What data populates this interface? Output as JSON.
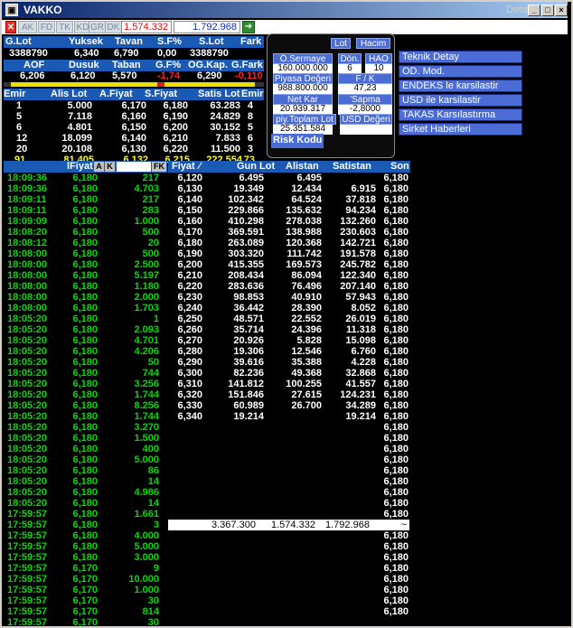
{
  "window": {
    "title": "VAKKO",
    "subtitle": "Detay",
    "sys_glyph": "▣",
    "min": "_",
    "max": "□",
    "close": "×"
  },
  "toolbar": {
    "buttons": [
      "✕",
      "AK",
      "FD",
      "TK",
      "KD",
      "GR",
      "DK"
    ],
    "value_red": "1.574.332",
    "value_blue": "1.792.968",
    "go": "➔"
  },
  "summary": {
    "headers1": [
      "G.Lot",
      "Yuksek",
      "Tavan",
      "S.F%",
      "S.Lot",
      "Fark"
    ],
    "values1": [
      "3388790",
      "6,340",
      "6,790",
      "0,00",
      "3388790",
      ""
    ],
    "headers2": [
      "AOF",
      "Dusuk",
      "Taban",
      "G.F%",
      "OG.Kap.",
      "G.Fark"
    ],
    "values2": [
      "6,206",
      "6,120",
      "5,570",
      "-1,74",
      "6,290",
      "-0,110"
    ]
  },
  "depth": {
    "headers": [
      "Emir",
      "Alis Lot",
      "A.Fiyat",
      "S.Fiyat",
      "Satis Lot",
      "Emir"
    ],
    "rows": [
      [
        "1",
        "5.000",
        "6,170",
        "6,180",
        "63.283",
        "4"
      ],
      [
        "5",
        "7.118",
        "6,160",
        "6,190",
        "24.829",
        "8"
      ],
      [
        "6",
        "4.801",
        "6,150",
        "6,200",
        "30.152",
        "5"
      ],
      [
        "12",
        "18.099",
        "6,140",
        "6,210",
        "7.833",
        "6"
      ],
      [
        "20",
        "20.108",
        "6,130",
        "6,220",
        "11.500",
        "3"
      ]
    ],
    "total": [
      "91",
      "81.405",
      "6,132",
      "6,215",
      "222.554",
      "73"
    ]
  },
  "info_panel": {
    "lot_btn": "Lot",
    "hacim_btn": "Hacim",
    "sermaye_label": "Ö.Sermaye",
    "sermaye_value": "160.000.000",
    "don_label": "Dön.",
    "don_value": "6",
    "hao_label": "HAO",
    "hao_value": "10",
    "piyasa_label": "Piyasa Değeri",
    "piyasa_value": "988.800.000",
    "fk_label": "F / K",
    "fk_value": "47,23",
    "netkar_label": "Net Kar",
    "netkar_value": "20.939.317",
    "sapma_label": "'Sapma",
    "sapma_value": "-2,8000",
    "toplam_label": "piy.Toplam Lot",
    "toplam_value": "25.351.584",
    "usd_label": "USD Değeri",
    "usd_value": "",
    "risk_label": "Risk Kodu"
  },
  "menu": [
    "Teknik Detay",
    "OD. Mod.",
    "ENDEKS le karsilastir",
    "USD ile karsilastir",
    "TAKAS Karsılastırma",
    "Sirket Haberleri"
  ],
  "trades": {
    "header_fiyat": "lFiyat",
    "btn_a": "A",
    "btn_k": "K",
    "btn_fk": "FK",
    "rows": [
      [
        "18:09:36",
        "6,180",
        "217"
      ],
      [
        "18:09:36",
        "6,180",
        "4.703"
      ],
      [
        "18:09:11",
        "6,180",
        "217"
      ],
      [
        "18:09:11",
        "6,180",
        "283"
      ],
      [
        "18:09:09",
        "6,180",
        "1.000"
      ],
      [
        "18:08:20",
        "6,180",
        "500"
      ],
      [
        "18:08:12",
        "6,180",
        "20"
      ],
      [
        "18:08:00",
        "6,180",
        "500"
      ],
      [
        "18:08:00",
        "6,180",
        "2.500"
      ],
      [
        "18:08:00",
        "6,180",
        "5.197"
      ],
      [
        "18:08:00",
        "6,180",
        "1.180"
      ],
      [
        "18:08:00",
        "6,180",
        "2.000"
      ],
      [
        "18:08:00",
        "6,180",
        "1.703"
      ],
      [
        "18:05:20",
        "6,180",
        "1"
      ],
      [
        "18:05:20",
        "6,180",
        "2.093"
      ],
      [
        "18:05:20",
        "6,180",
        "4.701"
      ],
      [
        "18:05:20",
        "6,180",
        "4.206"
      ],
      [
        "18:05:20",
        "6,180",
        "50"
      ],
      [
        "18:05:20",
        "6,180",
        "744"
      ],
      [
        "18:05:20",
        "6,180",
        "3.256"
      ],
      [
        "18:05:20",
        "6,180",
        "1.744"
      ],
      [
        "18:05:20",
        "6,180",
        "8.256"
      ],
      [
        "18:05:20",
        "6,180",
        "1.744"
      ],
      [
        "18:05:20",
        "6,180",
        "3.270"
      ],
      [
        "18:05:20",
        "6,180",
        "1.500"
      ],
      [
        "18:05:20",
        "6,180",
        "400"
      ],
      [
        "18:05:20",
        "6,180",
        "5.000"
      ],
      [
        "18:05:20",
        "6,180",
        "86"
      ],
      [
        "18:05:20",
        "6,180",
        "14"
      ],
      [
        "18:05:20",
        "6,180",
        "4.986"
      ],
      [
        "18:05:20",
        "6,180",
        "14"
      ],
      [
        "17:59:57",
        "6,180",
        "1.661"
      ],
      [
        "17:59:57",
        "6,180",
        "3"
      ],
      [
        "17:59:57",
        "6,180",
        "4.000"
      ],
      [
        "17:59:57",
        "6,180",
        "5.000"
      ],
      [
        "17:59:57",
        "6,180",
        "3.000"
      ],
      [
        "17:59:57",
        "6,170",
        "9"
      ],
      [
        "17:59:57",
        "6,170",
        "10.000"
      ],
      [
        "17:59:57",
        "6,170",
        "1.000"
      ],
      [
        "17:59:57",
        "6,170",
        "30"
      ],
      [
        "17:59:57",
        "6,170",
        "814"
      ],
      [
        "17:59:57",
        "6,170",
        "30"
      ]
    ]
  },
  "volume": {
    "headers": [
      "Fiyat",
      "Gun Lot",
      "Alistan",
      "Satistan",
      "Son"
    ],
    "rows": [
      [
        "6,120",
        "6.495",
        "6.495",
        "",
        "6,180"
      ],
      [
        "6,130",
        "19.349",
        "12.434",
        "6.915",
        "6,180"
      ],
      [
        "6,140",
        "102.342",
        "64.524",
        "37.818",
        "6,180"
      ],
      [
        "6,150",
        "229.866",
        "135.632",
        "94.234",
        "6,180"
      ],
      [
        "6,160",
        "410.298",
        "278.038",
        "132.260",
        "6,180"
      ],
      [
        "6,170",
        "369.591",
        "138.988",
        "230.603",
        "6,180"
      ],
      [
        "6,180",
        "263.089",
        "120.368",
        "142.721",
        "6,180"
      ],
      [
        "6,190",
        "303.320",
        "111.742",
        "191.578",
        "6,180"
      ],
      [
        "6,200",
        "415.355",
        "169.573",
        "245.782",
        "6,180"
      ],
      [
        "6,210",
        "208.434",
        "86.094",
        "122.340",
        "6,180"
      ],
      [
        "6,220",
        "283.636",
        "76.496",
        "207.140",
        "6,180"
      ],
      [
        "6,230",
        "98.853",
        "40.910",
        "57.943",
        "6,180"
      ],
      [
        "6,240",
        "36.442",
        "28.390",
        "8.052",
        "6,180"
      ],
      [
        "6,250",
        "48.571",
        "22.552",
        "26.019",
        "6,180"
      ],
      [
        "6,260",
        "35.714",
        "24.396",
        "11.318",
        "6,180"
      ],
      [
        "6,270",
        "20.926",
        "5.828",
        "15.098",
        "6,180"
      ],
      [
        "6,280",
        "19.306",
        "12.546",
        "6.760",
        "6,180"
      ],
      [
        "6,290",
        "39.616",
        "35.388",
        "4.228",
        "6,180"
      ],
      [
        "6,300",
        "82.236",
        "49.368",
        "32.868",
        "6,180"
      ],
      [
        "6,310",
        "141.812",
        "100.255",
        "41.557",
        "6,180"
      ],
      [
        "6,320",
        "151.846",
        "27.615",
        "124.231",
        "6,180"
      ],
      [
        "6,330",
        "60.989",
        "26.700",
        "34.289",
        "6,180"
      ],
      [
        "6,340",
        "19.214",
        "",
        "19.214",
        "6,180"
      ]
    ],
    "extra_son": [
      "6,180",
      "6,180",
      "6,180",
      "6,180",
      "6,180",
      "6,180",
      "6,180",
      "6,180",
      "6,180",
      "6,180",
      "6,180",
      "6,180",
      "6,180",
      "6,180",
      "6,180",
      "6,180",
      "6,180",
      "6,180"
    ],
    "totals": [
      "3.367.300",
      "1.574.332",
      "1.792.968",
      "~"
    ]
  },
  "colors": {
    "header_blue": "#1a5ab4",
    "menu_blue": "#4a6cd4",
    "green": "#00dd00",
    "yellow": "#ffff00"
  }
}
